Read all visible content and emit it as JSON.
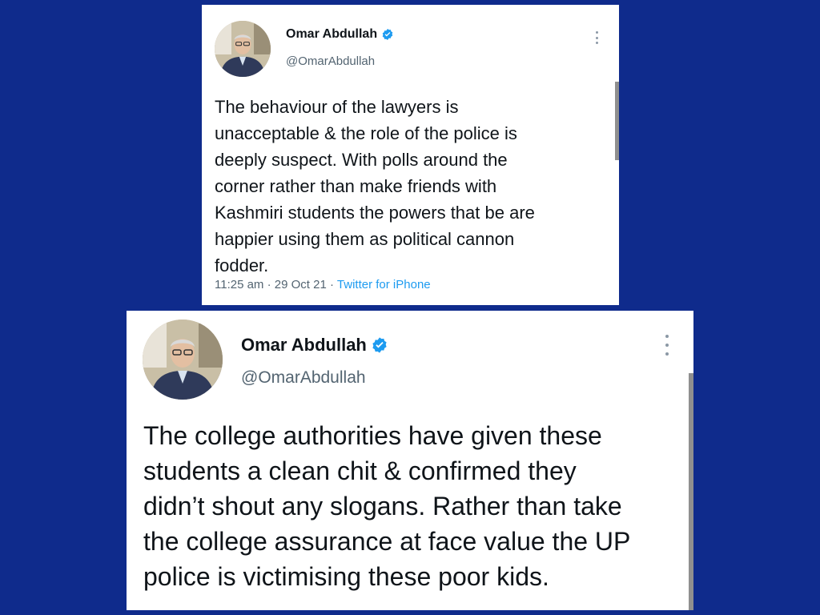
{
  "colors": {
    "background": "#0f2b8c",
    "card": "#ffffff",
    "verified": "#1d9bf0",
    "text": "#0f1419",
    "secondary": "#536471"
  },
  "tweets": [
    {
      "author_name": "Omar Abdullah",
      "handle": "@OmarAbdullah",
      "verified_icon": "verified-badge-icon",
      "more_icon": "more-options-icon",
      "text_lines": [
        "The behaviour of the lawyers is",
        "unacceptable & the role of the police is",
        "deeply suspect. With polls around the",
        "corner rather than make friends with",
        "Kashmiri students the powers that be are",
        "happier using them as political cannon",
        "fodder."
      ],
      "time": "11:25 am",
      "date": "29 Oct 21",
      "separator": "·",
      "source": "Twitter for iPhone"
    },
    {
      "author_name": "Omar Abdullah",
      "handle": "@OmarAbdullah",
      "verified_icon": "verified-badge-icon",
      "more_icon": "more-options-icon",
      "text_lines": [
        "The college authorities have given these",
        "students a clean chit & confirmed they",
        "didn’t shout any slogans. Rather than take",
        "the college assurance at face value the UP",
        "police is victimising these poor kids."
      ]
    }
  ]
}
